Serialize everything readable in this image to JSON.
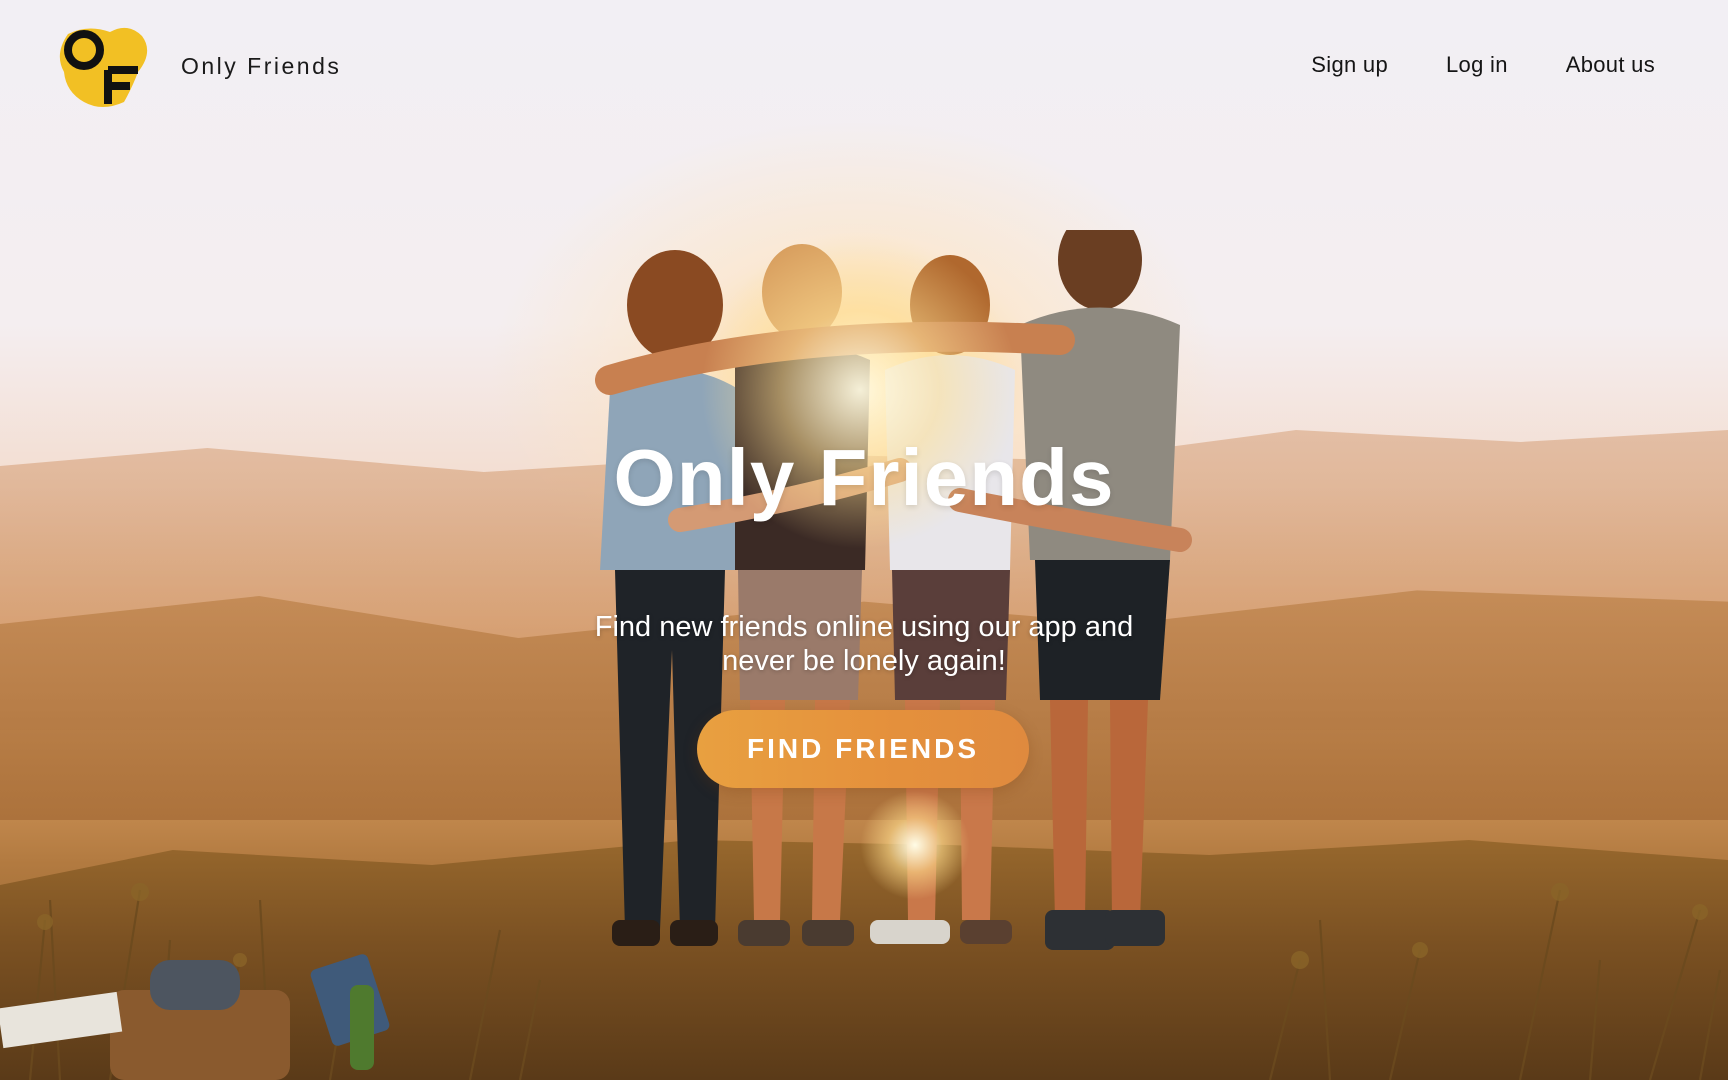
{
  "brand": {
    "logo_letters": "OF",
    "name": "Only Friends",
    "logo_color": "#f2c024"
  },
  "nav": {
    "items": [
      {
        "label": "Sign up"
      },
      {
        "label": "Log in"
      },
      {
        "label": "About us"
      }
    ]
  },
  "hero": {
    "title": "Only Friends",
    "subtitle": "Find new friends online using our app and never be lonely again!",
    "cta_label": "FIND FRIENDS",
    "cta_color": "#e5933e"
  }
}
